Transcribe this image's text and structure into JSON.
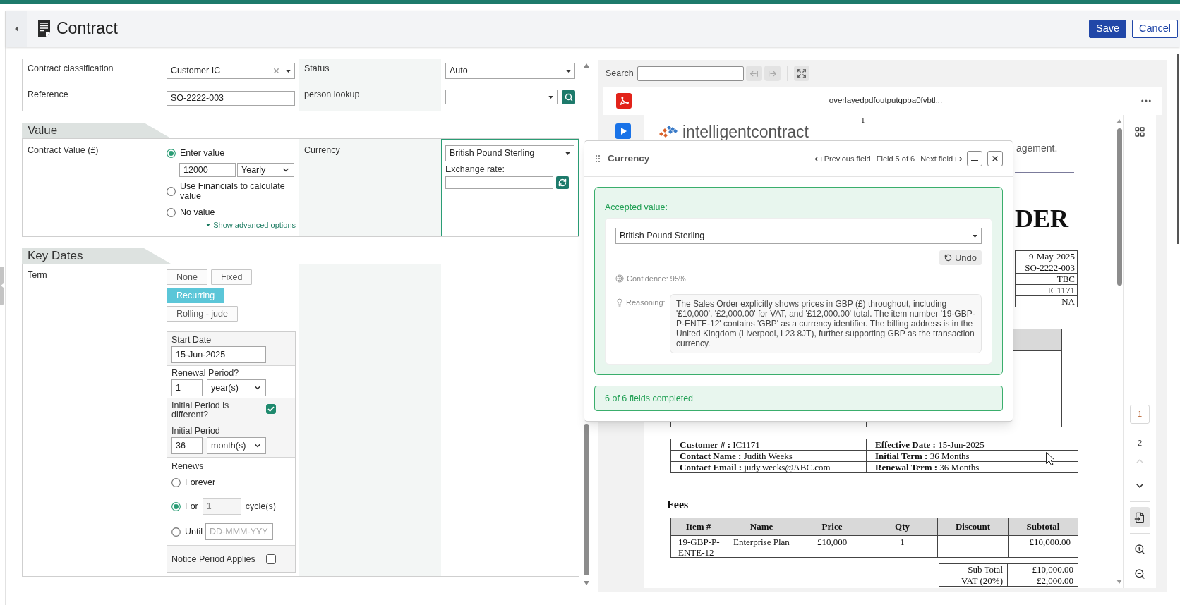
{
  "header": {
    "title": "Contract",
    "actions": [
      {
        "label": "Save",
        "kind": "primary"
      },
      {
        "label": "Cancel",
        "kind": "secondary"
      }
    ]
  },
  "general": {
    "fields": [
      {
        "label": "Contract classification",
        "kind": "select",
        "value": "Customer IC",
        "clearable": true
      },
      {
        "label": "Status",
        "kind": "select",
        "value": "Auto",
        "clearable": false
      },
      {
        "label": "Reference",
        "kind": "text",
        "value": "SO-2222-003"
      },
      {
        "label": "person lookup",
        "kind": "lookup"
      }
    ]
  },
  "value": {
    "title": "Value",
    "contract_value": {
      "label": "Contract Value (£)",
      "options": [
        {
          "label": "Enter value",
          "selected": true
        },
        {
          "label": "Use Financials to calculate value",
          "selected": false
        },
        {
          "label": "No value",
          "selected": false
        }
      ],
      "amount": "12000",
      "frequency": "Yearly",
      "advanced_link": "Show advanced options"
    },
    "currency": {
      "label": "Currency",
      "value": "British Pound Sterling",
      "focused": true,
      "exchange_rate_label": "Exchange rate:"
    }
  },
  "key_dates": {
    "title": "Key Dates",
    "term": {
      "label": "Term",
      "options": [
        {
          "label": "None",
          "selected": false
        },
        {
          "label": "Fixed",
          "selected": false
        },
        {
          "label": "Recurring",
          "selected": true
        },
        {
          "label": "Rolling - jude",
          "selected": false
        }
      ]
    },
    "start_date": {
      "label": "Start Date",
      "value": "15-Jun-2025"
    },
    "renewal_period": {
      "label": "Renewal Period?",
      "value": "1",
      "unit": "year(s)"
    },
    "initial_period_different": {
      "label": "Initial Period is different?",
      "checked": true
    },
    "initial_period": {
      "label": "Initial Period",
      "value": "36",
      "unit": "month(s)"
    },
    "renews": {
      "label": "Renews",
      "options": [
        {
          "kind": "plain",
          "label": "Forever",
          "selected": false
        },
        {
          "kind": "count",
          "label": "For",
          "value": "1",
          "disabled": true,
          "suffix": "cycle(s)",
          "selected": true
        },
        {
          "kind": "date",
          "label": "Until",
          "placeholder": "DD-MMM-YYY",
          "selected": false
        }
      ]
    },
    "notice_period": {
      "label": "Notice Period Applies",
      "checked": false
    }
  },
  "viewer": {
    "search_label": "Search",
    "file_name": "overlayedpdfoutputqpba0fvbtl...",
    "document": {
      "page_number": "1",
      "logo_text": "intelligentcontract",
      "tagline_fragment": "agement.",
      "heading_fragment": "DER",
      "summary_values": [
        "9-May-2025",
        "SO-2222-003",
        "TBC",
        "IC1171",
        "NA"
      ],
      "contact_rows": [
        {
          "left": "**Customer # :** IC1171",
          "right": "**Effective Date :** 15-Jun-2025"
        },
        {
          "left": "**Contact Name :** Judith Weeks",
          "right": "**Initial Term :** 36 Months"
        },
        {
          "left": "**Contact Email :** judy.weeks@ABC.com",
          "right": "**Renewal Term :** 36 Months"
        }
      ],
      "fees": {
        "title": "Fees",
        "columns": [
          "Item #",
          "Name",
          "Price",
          "Qty",
          "Discount",
          "Subtotal"
        ],
        "rows": [
          {
            "item": "19-GBP-P-ENTE-12",
            "name": "Enterprise Plan",
            "price": "£10,000",
            "qty": "1",
            "subtotal": "£10,000.00"
          }
        ]
      },
      "totals": [
        {
          "label": "Sub Total",
          "value": "£10,000.00"
        },
        {
          "label": "VAT (20%)",
          "value": "£2,000.00"
        }
      ]
    },
    "pages": [
      {
        "label": "1",
        "selected": true
      },
      {
        "label": "2",
        "selected": false
      }
    ]
  },
  "assistant": {
    "title": "Currency",
    "previous": "Previous field",
    "position": "Field 5 of 6",
    "next": "Next field",
    "accepted_label": "Accepted value:",
    "value": "British Pound Sterling",
    "undo": "Undo",
    "confidence": "Confidence: 95%",
    "reasoning_label": "Reasoning:",
    "reasoning": "The Sales Order explicitly shows prices in GBP (£) throughout, including '£10,000', '£2,000.00' for VAT, and '£12,000.00' total. The item number '19-GBP-P-ENTE-12' contains 'GBP' as a currency identifier. The billing address is in the United Kingdom (Liverpool, L23 8JT), further supporting GBP as the transaction currency.",
    "progress": "6 of 6 fields completed"
  }
}
